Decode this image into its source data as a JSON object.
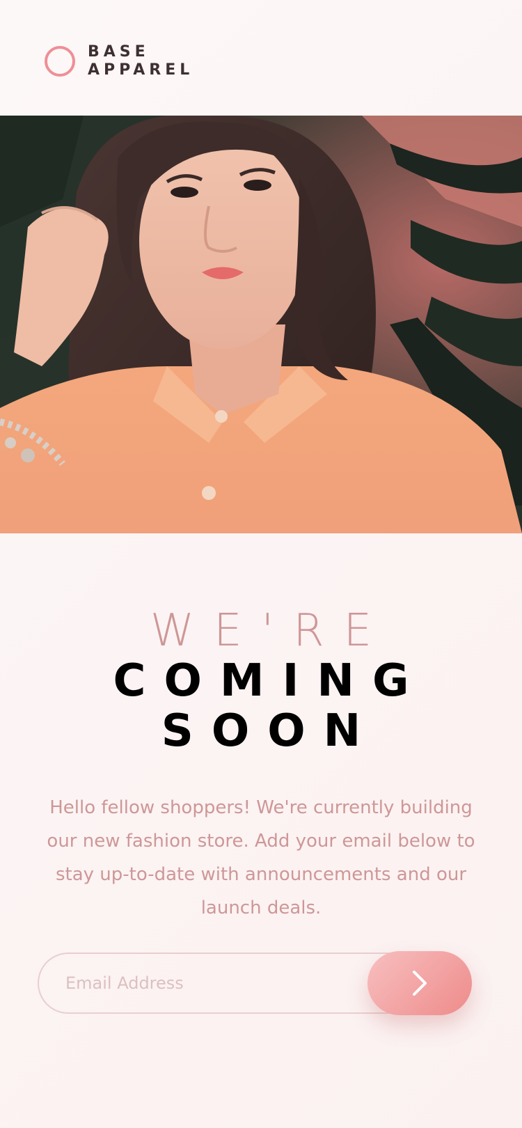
{
  "brand": {
    "line1": "BASE",
    "line2": "APPAREL",
    "accent_color": "#ee8f96"
  },
  "hero": {
    "image_icon": "woman-portrait-photo"
  },
  "headline": {
    "light": "WE'RE",
    "dark_line1": "COMING",
    "dark_line2": "SOON"
  },
  "description": "Hello fellow shoppers! We're currently building our new fashion store. Add your email below to stay up-to-date with announcements and our launch deals.",
  "form": {
    "email_value": "",
    "email_placeholder": "Email Address",
    "submit_icon": "chevron-right-icon"
  },
  "colors": {
    "text_pink": "#ce9797",
    "text_dark": "#3e3031",
    "button_start": "#f8bfbf",
    "button_end": "#ee8b8b"
  }
}
